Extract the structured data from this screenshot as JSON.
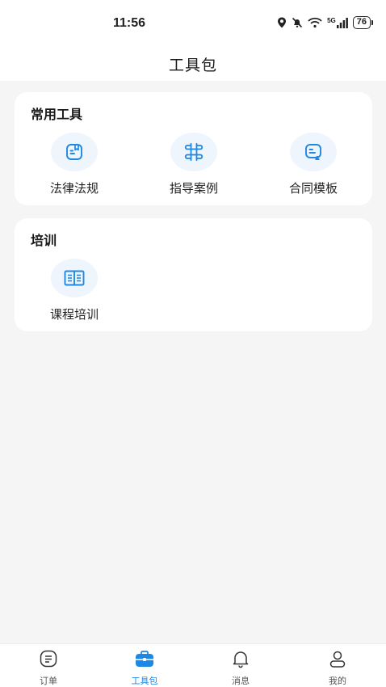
{
  "status_bar": {
    "time": "11:56",
    "network": "5G",
    "battery": "76"
  },
  "header": {
    "title": "工具包"
  },
  "sections": [
    {
      "title": "常用工具",
      "items": [
        {
          "label": "法律法规",
          "icon": "law-document-icon"
        },
        {
          "label": "指导案例",
          "icon": "case-grid-icon"
        },
        {
          "label": "合同模板",
          "icon": "contract-template-icon"
        }
      ]
    },
    {
      "title": "培训",
      "items": [
        {
          "label": "课程培训",
          "icon": "open-book-icon"
        }
      ]
    }
  ],
  "tabbar": {
    "items": [
      {
        "label": "订单",
        "icon": "order-icon",
        "active": false
      },
      {
        "label": "工具包",
        "icon": "toolbox-icon",
        "active": true
      },
      {
        "label": "消息",
        "icon": "bell-icon",
        "active": false
      },
      {
        "label": "我的",
        "icon": "user-icon",
        "active": false
      }
    ]
  },
  "colors": {
    "accent": "#1e88e5",
    "background": "#f5f5f5",
    "icon_bg": "#eef5fc"
  }
}
